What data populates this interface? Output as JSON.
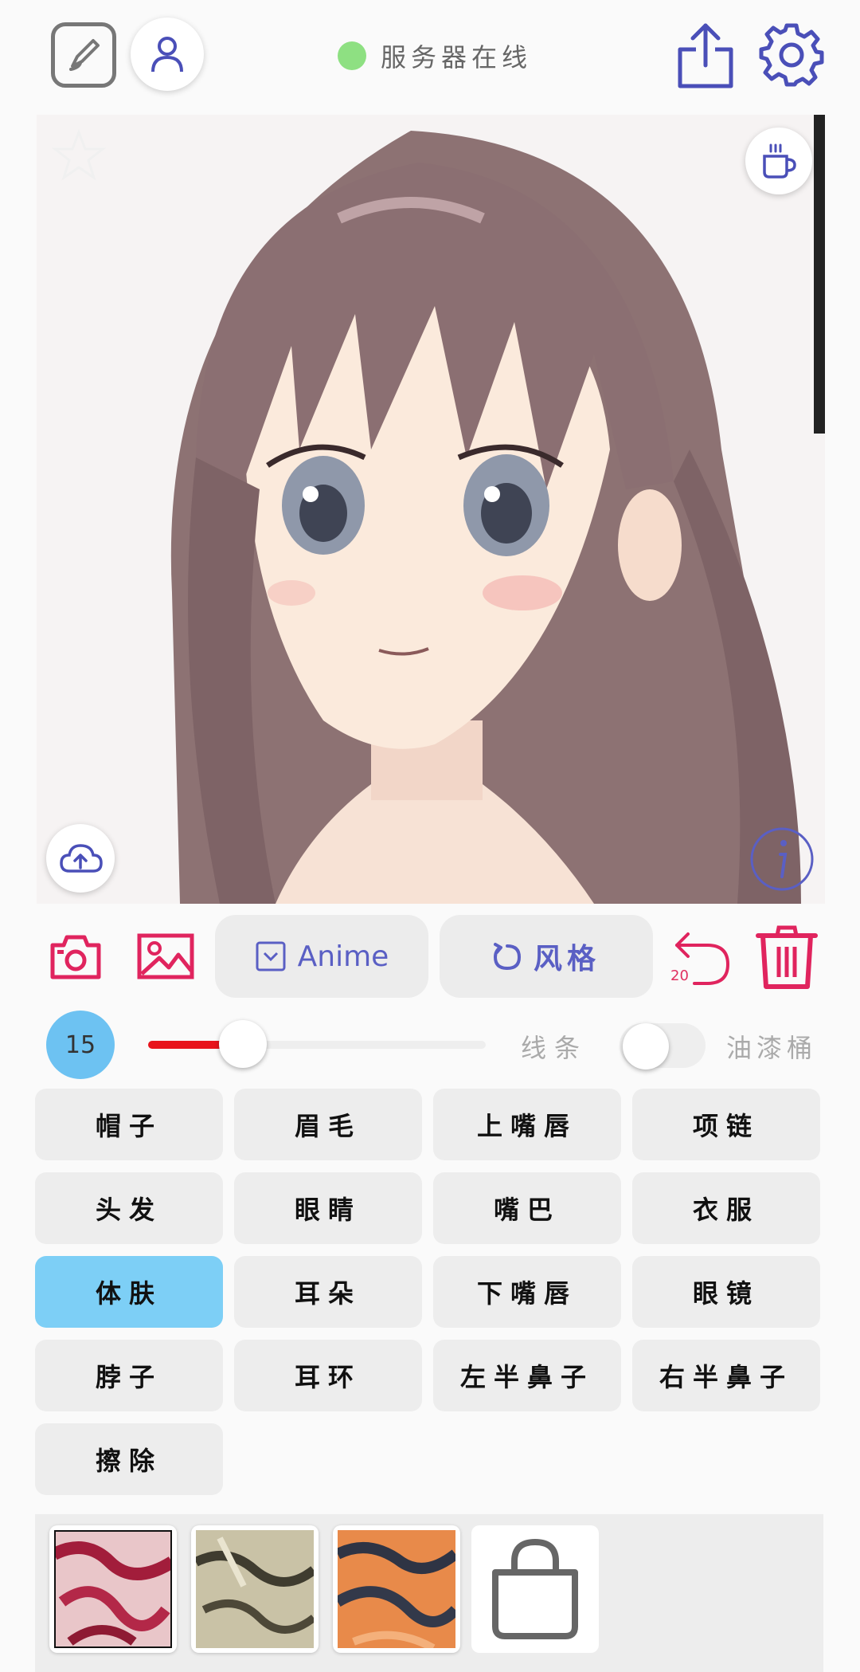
{
  "header": {
    "status_text": "服务器在线",
    "status_color": "#8ee082"
  },
  "toolbar": {
    "model_label": "Anime",
    "style_label": "风格",
    "undo_count": "20"
  },
  "brush": {
    "size": "15",
    "size_fraction": 0.28,
    "line_label": "线条",
    "bucket_label": "油漆桶",
    "bucket_enabled": false
  },
  "parts": [
    {
      "label": "帽子"
    },
    {
      "label": "眉毛"
    },
    {
      "label": "上嘴唇"
    },
    {
      "label": "项链"
    },
    {
      "label": "头发"
    },
    {
      "label": "眼睛"
    },
    {
      "label": "嘴巴"
    },
    {
      "label": "衣服"
    },
    {
      "label": "体肤"
    },
    {
      "label": "耳朵"
    },
    {
      "label": "下嘴唇"
    },
    {
      "label": "眼镜"
    },
    {
      "label": "脖子"
    },
    {
      "label": "耳环"
    },
    {
      "label": "左半鼻子"
    },
    {
      "label": "右半鼻子"
    },
    {
      "label": "擦除"
    }
  ],
  "selected_part": "体肤",
  "colors": {
    "accent": "#5a5fc4",
    "danger": "#e0245e",
    "slider": "#e8141c",
    "selected": "#7dcff6"
  },
  "icons": [
    "edit-canvas-icon",
    "user-icon",
    "share-icon",
    "gear-icon",
    "star-icon",
    "coffee-icon",
    "cloud-upload-icon",
    "info-icon",
    "camera-icon",
    "image-icon",
    "checkbox-icon",
    "refresh-icon",
    "undo-icon",
    "trash-icon",
    "shopping-bag-icon"
  ]
}
